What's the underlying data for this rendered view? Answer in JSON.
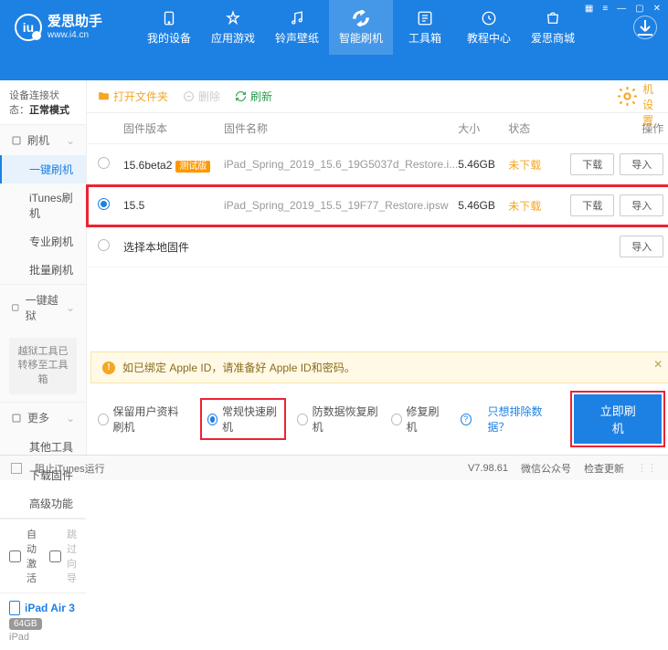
{
  "brand": {
    "title": "爱思助手",
    "sub": "www.i4.cn",
    "logo_glyph": "iu"
  },
  "win_controls": {
    "grid": "▦",
    "menu": "≡",
    "min": "—",
    "max": "▢",
    "close": "✕"
  },
  "nav": [
    {
      "label": "我的设备",
      "icon": "device"
    },
    {
      "label": "应用游戏",
      "icon": "app"
    },
    {
      "label": "铃声壁纸",
      "icon": "music"
    },
    {
      "label": "智能刷机",
      "icon": "flash",
      "active": true
    },
    {
      "label": "工具箱",
      "icon": "tools"
    },
    {
      "label": "教程中心",
      "icon": "edu"
    },
    {
      "label": "爱思商城",
      "icon": "shop"
    }
  ],
  "sidebar": {
    "conn_label": "设备连接状态：",
    "conn_value": "正常模式",
    "groups": [
      {
        "title": "刷机",
        "icon": "refresh",
        "items": [
          {
            "label": "一键刷机",
            "active": true
          },
          {
            "label": "iTunes刷机"
          },
          {
            "label": "专业刷机"
          },
          {
            "label": "批量刷机"
          }
        ]
      },
      {
        "title": "一键越狱",
        "icon": "lock",
        "note": "越狱工具已转移至工具箱"
      },
      {
        "title": "更多",
        "icon": "more",
        "items": [
          {
            "label": "其他工具"
          },
          {
            "label": "下载固件"
          },
          {
            "label": "高级功能"
          }
        ]
      }
    ],
    "auto_activate": "自动激活",
    "skip_guide": "跳过向导",
    "device": {
      "name": "iPad Air 3",
      "storage": "64GB",
      "model": "iPad"
    }
  },
  "toolbar": {
    "open_folder": "打开文件夹",
    "delete": "删除",
    "refresh": "刷新",
    "settings": "刷机设置"
  },
  "table": {
    "headers": {
      "version": "固件版本",
      "name": "固件名称",
      "size": "大小",
      "status": "状态",
      "actions": "操作"
    },
    "rows": [
      {
        "version": "15.6beta2",
        "beta": "测试版",
        "name": "iPad_Spring_2019_15.6_19G5037d_Restore.i...",
        "size": "5.46GB",
        "status": "未下载",
        "selected": false
      },
      {
        "version": "15.5",
        "name": "iPad_Spring_2019_15.5_19F77_Restore.ipsw",
        "size": "5.46GB",
        "status": "未下载",
        "selected": true,
        "highlight": true
      }
    ],
    "local_option": "选择本地固件",
    "btn_download": "下载",
    "btn_import": "导入"
  },
  "warning": {
    "text": "如已绑定 Apple ID，请准备好 Apple ID和密码。"
  },
  "modes": {
    "options": [
      {
        "label": "保留用户资料刷机"
      },
      {
        "label": "常规快速刷机",
        "selected": true,
        "highlight": true
      },
      {
        "label": "防数据恢复刷机"
      },
      {
        "label": "修复刷机"
      }
    ],
    "exclude_link": "只想排除数据？",
    "primary": "立即刷机"
  },
  "footer": {
    "block_itunes": "阻止iTunes运行",
    "version": "V7.98.61",
    "wechat": "微信公众号",
    "check_update": "检查更新"
  }
}
